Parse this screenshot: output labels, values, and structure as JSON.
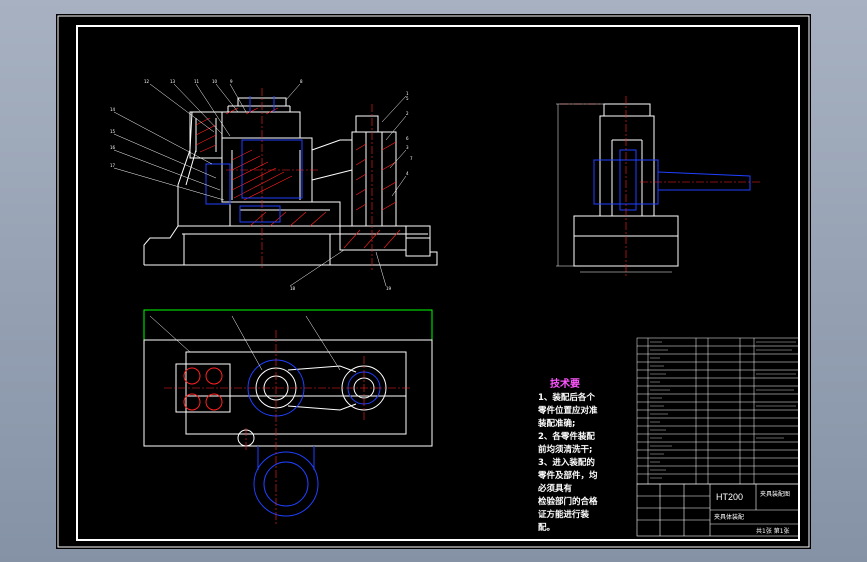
{
  "colors": {
    "background": "#000000",
    "outline": "#ffffff",
    "hidden_lines": "#0000ff",
    "section_hatch": "#ff2020",
    "centerline": "#ff2020",
    "requirements_title": "#ff55ff",
    "balloon_leader": "#ffffff",
    "selection_box": "#00ff00"
  },
  "balloon_tags": [
    "12",
    "13",
    "11",
    "10",
    "9",
    "8",
    "14",
    "15",
    "16",
    "17",
    "1",
    "2",
    "3",
    "4",
    "5",
    "6",
    "7",
    "18",
    "19"
  ],
  "technical_requirements": {
    "title": "技术要",
    "lines": [
      "1、装配后各个",
      "零件位置应对准",
      "装配准确;",
      "2、各零件装配",
      "前均须清洗干;",
      "3、进入装配的",
      "零件及部件，均",
      "必须具有",
      "检验部门的合格",
      "证方能进行装",
      "配。"
    ]
  },
  "title_block": {
    "material": "HT200",
    "drawing_name": "夹具装配图",
    "part_name": "夹具体装配",
    "sheet_info": "共1张 第1张"
  }
}
